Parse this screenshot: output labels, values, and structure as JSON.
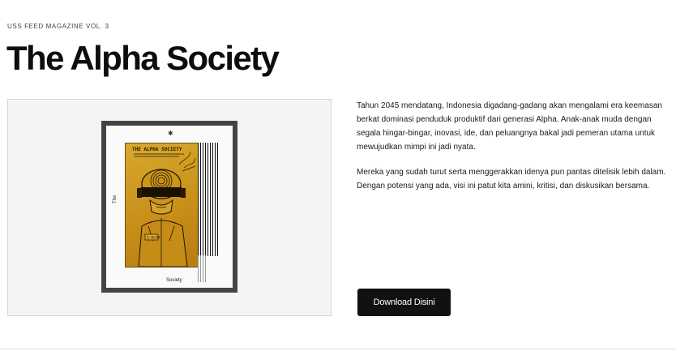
{
  "header": {
    "eyebrow": "USS FEED MAGAZINE VOL. 3",
    "title": "The Alpha Society"
  },
  "cover": {
    "spine_text": "The",
    "bottom_label": "Society",
    "poster_title": "THE ALPHA SOCIETY",
    "badge_text": "I-ALPA"
  },
  "description": {
    "paragraph_1": "Tahun 2045 mendatang, Indonesia digadang-gadang akan mengalami era keemasan berkat dominasi penduduk produktif dari generasi Alpha. Anak-anak muda dengan segala hingar-bingar, inovasi, ide, dan peluangnya bakal jadi pemeran utama untuk mewujudkan mimpi ini jadi nyata.",
    "paragraph_2": "Mereka yang sudah turut serta menggerakkan idenya pun pantas ditelisik lebih dalam. Dengan potensi yang ada, visi ini patut kita amini, kritisi, dan diskusikan bersama."
  },
  "actions": {
    "download_label": "Download Disini"
  }
}
